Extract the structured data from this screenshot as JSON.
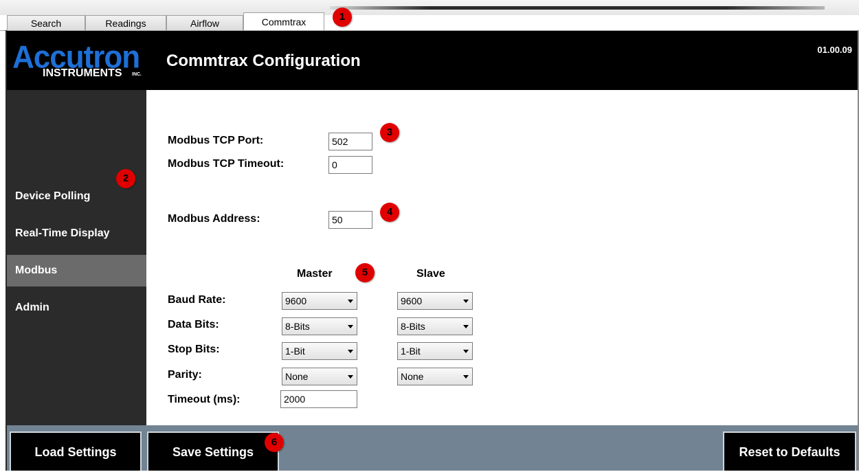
{
  "tabs": [
    {
      "label": "Search"
    },
    {
      "label": "Readings"
    },
    {
      "label": "Airflow"
    },
    {
      "label": "Commtrax"
    }
  ],
  "header": {
    "logo_main": "Accutron",
    "logo_sub": "INSTRUMENTS",
    "logo_inc": "INC.",
    "title": "Commtrax Configuration",
    "version": "01.00.09"
  },
  "sidebar": {
    "items": [
      {
        "label": "Device Polling"
      },
      {
        "label": "Real-Time Display"
      },
      {
        "label": "Modbus",
        "active": true
      },
      {
        "label": "Admin"
      }
    ]
  },
  "tcp": {
    "port_label": "Modbus TCP Port:",
    "port_value": "502",
    "timeout_label": "Modbus TCP Timeout:",
    "timeout_value": "0"
  },
  "address": {
    "label": "Modbus Address:",
    "value": "50"
  },
  "serial": {
    "master_heading": "Master",
    "slave_heading": "Slave",
    "baud_label": "Baud Rate:",
    "data_bits_label": "Data Bits:",
    "stop_bits_label": "Stop Bits:",
    "parity_label": "Parity:",
    "timeout_label": "Timeout (ms):",
    "master": {
      "baud": "9600",
      "data_bits": "8-Bits",
      "stop_bits": "1-Bit",
      "parity": "None",
      "timeout": "2000"
    },
    "slave": {
      "baud": "9600",
      "data_bits": "8-Bits",
      "stop_bits": "1-Bit",
      "parity": "None"
    }
  },
  "footer": {
    "load_label": "Load Settings",
    "save_label": "Save Settings",
    "reset_label": "Reset to Defaults"
  },
  "callouts": [
    "1",
    "2",
    "3",
    "4",
    "5",
    "6"
  ],
  "colors": {
    "header_bg": "#000000",
    "logo_blue": "#1e6fd6",
    "sidebar_bg": "#2b2b2b",
    "sidebar_active": "#6b6b6b",
    "footer_bg": "#728393",
    "callout_red": "#e00000"
  }
}
